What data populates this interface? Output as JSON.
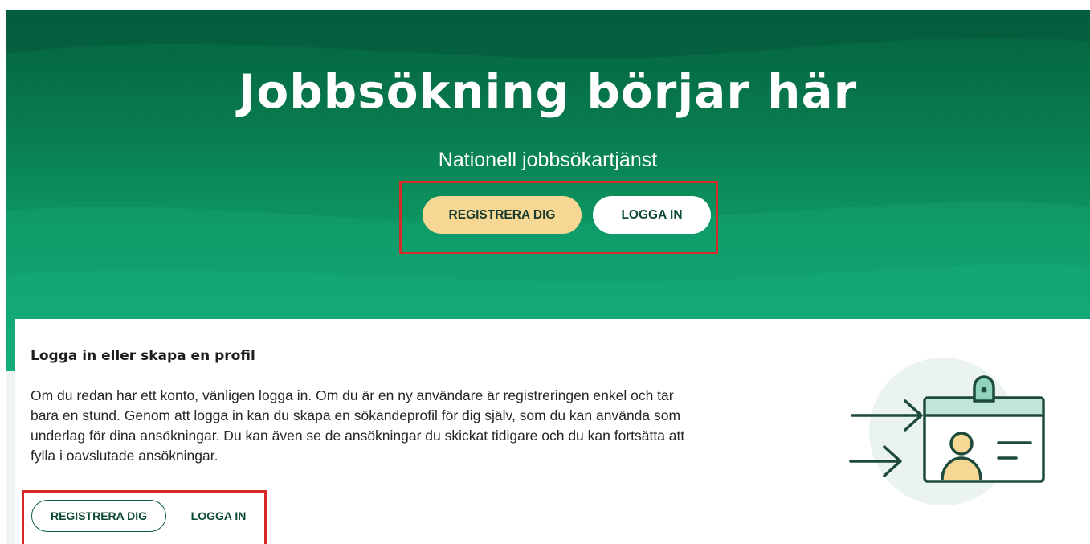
{
  "hero": {
    "title": "Jobbsökning börjar här",
    "subtitle": "Nationell jobbsökartjänst",
    "register_label": "REGISTRERA DIG",
    "login_label": "LOGGA IN"
  },
  "card": {
    "title": "Logga in eller skapa en profil",
    "body": "Om du redan har ett konto, vänligen logga in. Om du är en ny användare är registreringen enkel och tar bara en stund. Genom att logga in kan du skapa en sökandeprofil för dig själv, som du kan använda som underlag för dina ansökningar. Du kan även se de ansökningar du skickat tidigare och du kan fortsätta att fylla i oavslutade ansökningar.",
    "register_label": "REGISTRERA DIG",
    "login_label": "LOGGA IN",
    "illustration_icon": "id-badge-login-icon"
  },
  "colors": {
    "hero_dark": "#04623f",
    "hero_light": "#14a978",
    "register_button_bg": "#f6d894",
    "highlight_border": "#d52a27",
    "button_text_green": "#0d4a32"
  }
}
